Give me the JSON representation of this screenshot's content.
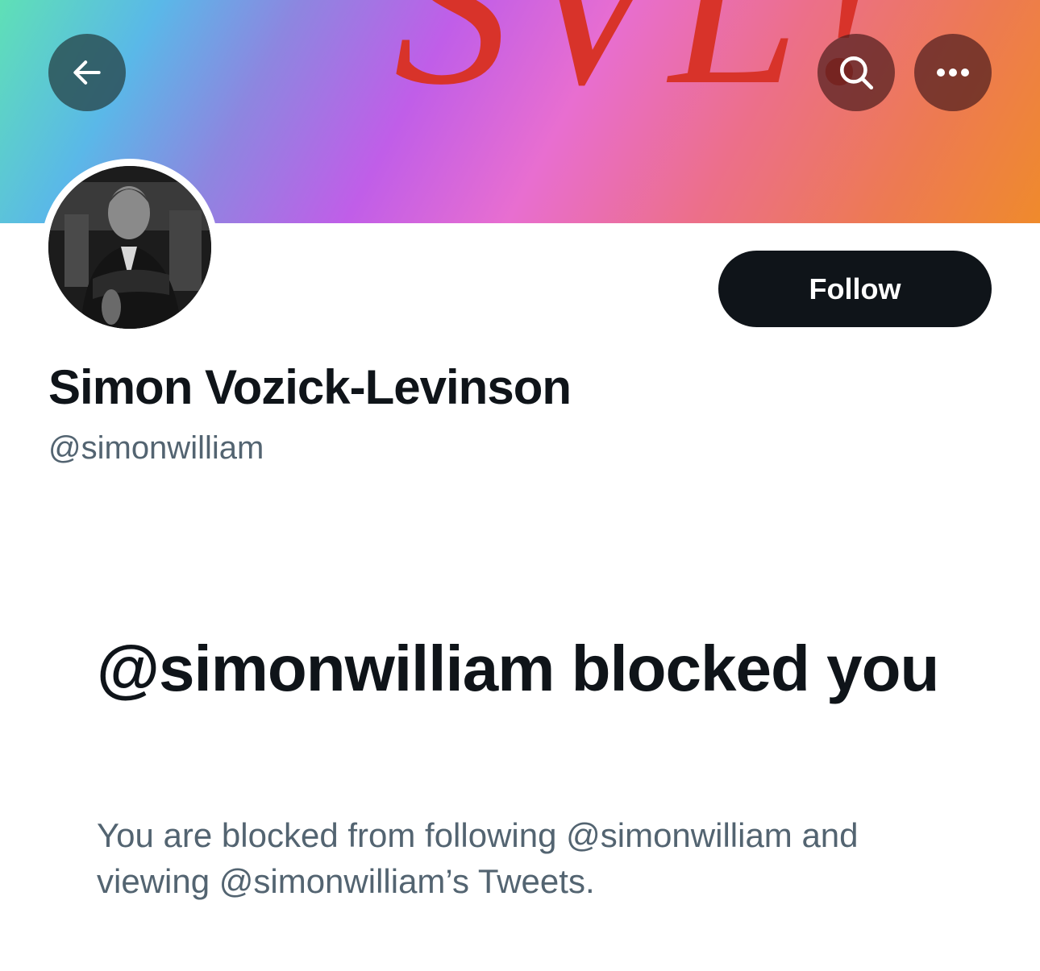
{
  "banner": {
    "text": "SVL!",
    "text_color": "#d8332a"
  },
  "header": {
    "back_icon": "arrow-left-icon",
    "search_icon": "search-icon",
    "more_icon": "more-horizontal-icon"
  },
  "profile": {
    "display_name": "Simon Vozick-Levinson",
    "handle": "@simonwilliam",
    "follow_label": "Follow",
    "follow_button_color": "#0f1419"
  },
  "blocked": {
    "title": "@simonwilliam blocked you",
    "description": "You are blocked from following @simonwilliam and viewing @simonwilliam’s Tweets."
  },
  "colors": {
    "text_primary": "#0f1419",
    "text_secondary": "#536471"
  }
}
